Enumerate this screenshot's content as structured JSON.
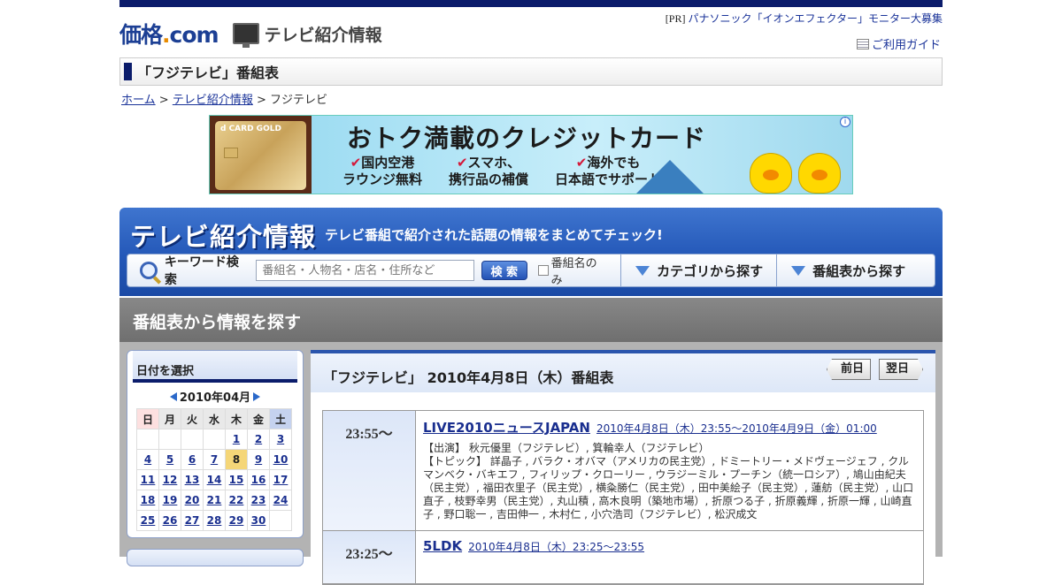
{
  "header": {
    "logo_main": "価格",
    "logo_dot": ".",
    "logo_com": "com",
    "section_title": "テレビ紹介情報",
    "pr_tag": "[PR]",
    "pr_link": "パナソニック「イオンエフェクター」モニター大募集",
    "guide_link": "ご利用ガイド"
  },
  "page": {
    "title": "「フジテレビ」番組表"
  },
  "breadcrumb": {
    "home": "ホーム",
    "sep1": ">",
    "tv_info": "テレビ紹介情報",
    "sep2": ">",
    "current": "フジテレビ"
  },
  "ad": {
    "card_label": "d CARD GOLD",
    "headline": "おトク満載のクレジットカード",
    "features": [
      {
        "line1": "国内空港",
        "line2": "ラウンジ無料"
      },
      {
        "line1": "スマホ、",
        "line2": "携行品の補償"
      },
      {
        "line1": "海外でも",
        "line2": "日本語でサポート"
      }
    ],
    "info": "i"
  },
  "tvbox": {
    "title": "テレビ紹介情報",
    "subtitle": "テレビ番組で紹介された話題の情報をまとめてチェック!",
    "keyword_label": "キーワード検索",
    "keyword_placeholder": "番組名・人物名・店名・住所など",
    "search_button": "検 索",
    "checkbox_label": "番組名のみ",
    "tab_category": "カテゴリから探す",
    "tab_schedule": "番組表から探す"
  },
  "section": {
    "title": "番組表から情報を探す"
  },
  "calendar": {
    "title": "日付を選択",
    "month": "2010年04月",
    "weekdays": [
      "日",
      "月",
      "火",
      "水",
      "木",
      "金",
      "土"
    ],
    "weeks": [
      [
        "",
        "",
        "",
        "",
        "1",
        "2",
        "3"
      ],
      [
        "4",
        "5",
        "6",
        "7",
        "8",
        "9",
        "10"
      ],
      [
        "11",
        "12",
        "13",
        "14",
        "15",
        "16",
        "17"
      ],
      [
        "18",
        "19",
        "20",
        "21",
        "22",
        "23",
        "24"
      ],
      [
        "25",
        "26",
        "27",
        "28",
        "29",
        "30",
        ""
      ]
    ],
    "selected_day": "8"
  },
  "schedule": {
    "heading": "「フジテレビ」 2010年4月8日（木）番組表",
    "prev_label": "前日",
    "next_label": "翌日",
    "programs": [
      {
        "time": "23:55～",
        "title": "LIVE2010ニュースJAPAN",
        "datetime": "2010年4月8日（木）23:55～2010年4月9日（金）01:00",
        "description": "【出演】 秋元優里（フジテレビ）, 箕輪幸人（フジテレビ）\n【トピック】 詳晶子 , バラク・オバマ（アメリカの民主党）, ドミートリー・メドヴェージェフ , クルマンベク・バキエフ , フィリップ・クローリー , ウラジーミル・プーチン（統一ロシア）, 鳩山由紀夫（民主党）, 福田衣里子（民主党）, 横粂勝仁（民主党）, 田中美絵子（民主党）, 蓮舫（民主党）, 山口直子 , 枝野幸男（民主党）, 丸山積 , 高木良明（築地市場）, 折原つる子 , 折原義輝 , 折原一輝 , 山崎直子 , 野口聡一 , 吉田伸一 , 木村仁 , 小穴浩司（フジテレビ）, 松沢成文"
      },
      {
        "time": "23:25～",
        "title": "5LDK",
        "datetime": "2010年4月8日（木）23:25～23:55",
        "description": ""
      }
    ]
  },
  "colors": {
    "navy": "#0b1c6b",
    "blue": "#2458b8",
    "link": "#1a3399",
    "gray_bar": "#777777"
  }
}
